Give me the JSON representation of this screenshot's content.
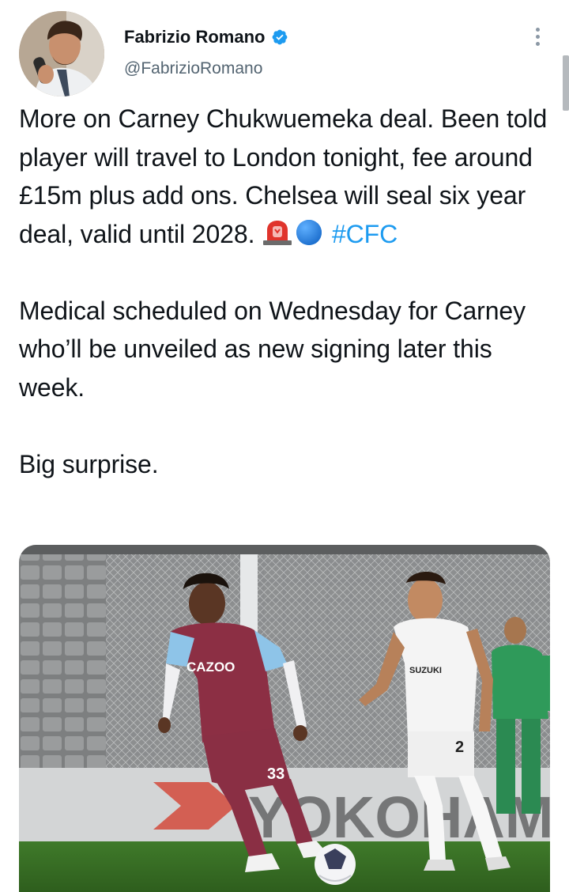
{
  "author": {
    "name": "Fabrizio Romano",
    "handle": "@FabrizioRomano",
    "verified": true
  },
  "tweet": {
    "paragraph1": "More on Carney Chukwuemeka deal. Been told player will travel to London tonight, fee around £15m plus add ons. Chelsea will seal six year deal, valid until 2028.",
    "hashtag": "#CFC",
    "emojis": [
      "rotating-light",
      "blue-circle"
    ],
    "paragraph2": "Medical scheduled on Wednesday for Carney who’ll be unveiled as new signing later this week.",
    "paragraph3": "Big surprise."
  },
  "media": {
    "shirt_left_sponsor": "CAZOO",
    "shirt_left_number": "33",
    "shirt_right_sponsor": "SUZUKI",
    "shirt_right_number": "2",
    "hoarding_text": "YOKOHAMA"
  },
  "colors": {
    "accent": "#1d9bf0",
    "text": "#0f1419",
    "secondary": "#536471"
  }
}
